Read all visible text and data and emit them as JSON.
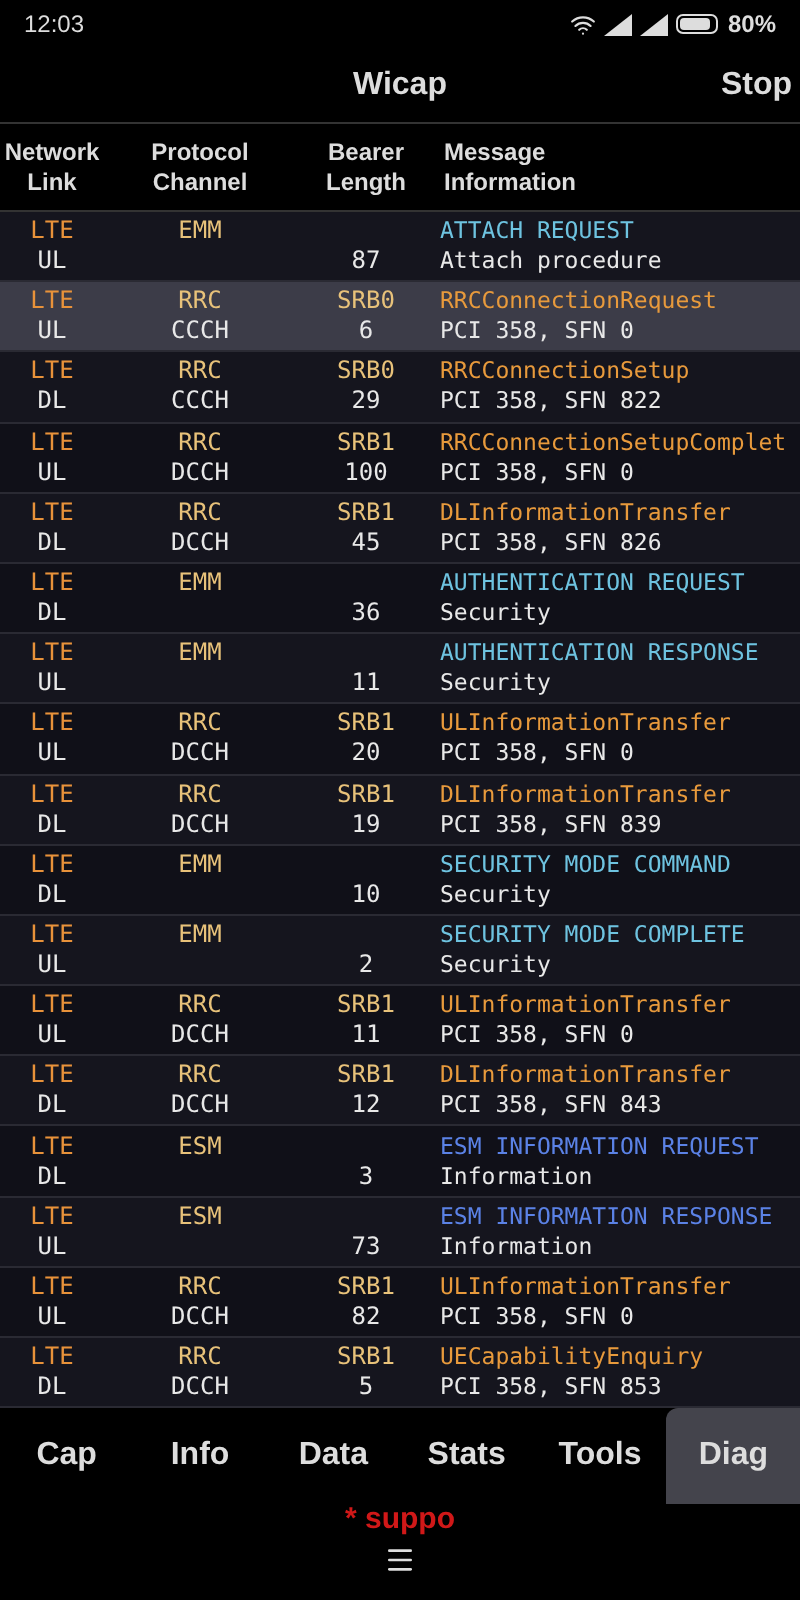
{
  "status_bar": {
    "time": "12:03",
    "battery": "80%"
  },
  "title_bar": {
    "title": "Wicap",
    "action": "Stop"
  },
  "table": {
    "columns": [
      [
        "Network",
        "Link"
      ],
      [
        "Protocol",
        "Channel"
      ],
      [
        "Bearer",
        "Length"
      ],
      [
        "Message",
        "Information"
      ]
    ],
    "rows": [
      {
        "network": "LTE",
        "link": "UL",
        "protocol": "EMM",
        "channel": "",
        "bearer": "",
        "length": "87",
        "message": "ATTACH REQUEST",
        "info": "Attach procedure",
        "kind": "emm",
        "selected": false
      },
      {
        "network": "LTE",
        "link": "UL",
        "protocol": "RRC",
        "channel": "CCCH",
        "bearer": "SRB0",
        "length": "6",
        "message": "RRCConnectionRequest",
        "info": "PCI 358, SFN 0",
        "kind": "rrc",
        "selected": true
      },
      {
        "network": "LTE",
        "link": "DL",
        "protocol": "RRC",
        "channel": "CCCH",
        "bearer": "SRB0",
        "length": "29",
        "message": "RRCConnectionSetup",
        "info": "PCI 358, SFN 822",
        "kind": "rrc",
        "selected": false
      },
      {
        "network": "LTE",
        "link": "UL",
        "protocol": "RRC",
        "channel": "DCCH",
        "bearer": "SRB1",
        "length": "100",
        "message": "RRCConnectionSetupComplet",
        "info": "PCI 358, SFN 0",
        "kind": "rrc",
        "selected": false
      },
      {
        "network": "LTE",
        "link": "DL",
        "protocol": "RRC",
        "channel": "DCCH",
        "bearer": "SRB1",
        "length": "45",
        "message": "DLInformationTransfer",
        "info": "PCI 358, SFN 826",
        "kind": "rrc",
        "selected": false
      },
      {
        "network": "LTE",
        "link": "DL",
        "protocol": "EMM",
        "channel": "",
        "bearer": "",
        "length": "36",
        "message": "AUTHENTICATION REQUEST",
        "info": "Security",
        "kind": "emm",
        "selected": false
      },
      {
        "network": "LTE",
        "link": "UL",
        "protocol": "EMM",
        "channel": "",
        "bearer": "",
        "length": "11",
        "message": "AUTHENTICATION RESPONSE",
        "info": "Security",
        "kind": "emm",
        "selected": false
      },
      {
        "network": "LTE",
        "link": "UL",
        "protocol": "RRC",
        "channel": "DCCH",
        "bearer": "SRB1",
        "length": "20",
        "message": "ULInformationTransfer",
        "info": "PCI 358, SFN 0",
        "kind": "rrc",
        "selected": false
      },
      {
        "network": "LTE",
        "link": "DL",
        "protocol": "RRC",
        "channel": "DCCH",
        "bearer": "SRB1",
        "length": "19",
        "message": "DLInformationTransfer",
        "info": "PCI 358, SFN 839",
        "kind": "rrc",
        "selected": false
      },
      {
        "network": "LTE",
        "link": "DL",
        "protocol": "EMM",
        "channel": "",
        "bearer": "",
        "length": "10",
        "message": "SECURITY MODE COMMAND",
        "info": "Security",
        "kind": "emm",
        "selected": false
      },
      {
        "network": "LTE",
        "link": "UL",
        "protocol": "EMM",
        "channel": "",
        "bearer": "",
        "length": "2",
        "message": "SECURITY MODE COMPLETE",
        "info": "Security",
        "kind": "emm",
        "selected": false
      },
      {
        "network": "LTE",
        "link": "UL",
        "protocol": "RRC",
        "channel": "DCCH",
        "bearer": "SRB1",
        "length": "11",
        "message": "ULInformationTransfer",
        "info": "PCI 358, SFN 0",
        "kind": "rrc",
        "selected": false
      },
      {
        "network": "LTE",
        "link": "DL",
        "protocol": "RRC",
        "channel": "DCCH",
        "bearer": "SRB1",
        "length": "12",
        "message": "DLInformationTransfer",
        "info": "PCI 358, SFN 843",
        "kind": "rrc",
        "selected": false
      },
      {
        "network": "LTE",
        "link": "DL",
        "protocol": "ESM",
        "channel": "",
        "bearer": "",
        "length": "3",
        "message": "ESM INFORMATION REQUEST",
        "info": "Information",
        "kind": "esm",
        "selected": false
      },
      {
        "network": "LTE",
        "link": "UL",
        "protocol": "ESM",
        "channel": "",
        "bearer": "",
        "length": "73",
        "message": "ESM INFORMATION RESPONSE",
        "info": "Information",
        "kind": "esm",
        "selected": false
      },
      {
        "network": "LTE",
        "link": "UL",
        "protocol": "RRC",
        "channel": "DCCH",
        "bearer": "SRB1",
        "length": "82",
        "message": "ULInformationTransfer",
        "info": "PCI 358, SFN 0",
        "kind": "rrc",
        "selected": false
      },
      {
        "network": "LTE",
        "link": "DL",
        "protocol": "RRC",
        "channel": "DCCH",
        "bearer": "SRB1",
        "length": "5",
        "message": "UECapabilityEnquiry",
        "info": "PCI 358, SFN 853",
        "kind": "rrc",
        "selected": false
      }
    ]
  },
  "tabs": [
    {
      "label": "Cap",
      "selected": false
    },
    {
      "label": "Info",
      "selected": false
    },
    {
      "label": "Data",
      "selected": false
    },
    {
      "label": "Stats",
      "selected": false
    },
    {
      "label": "Tools",
      "selected": false
    },
    {
      "label": "Diag",
      "selected": true
    }
  ],
  "footer_note": "* suppo"
}
